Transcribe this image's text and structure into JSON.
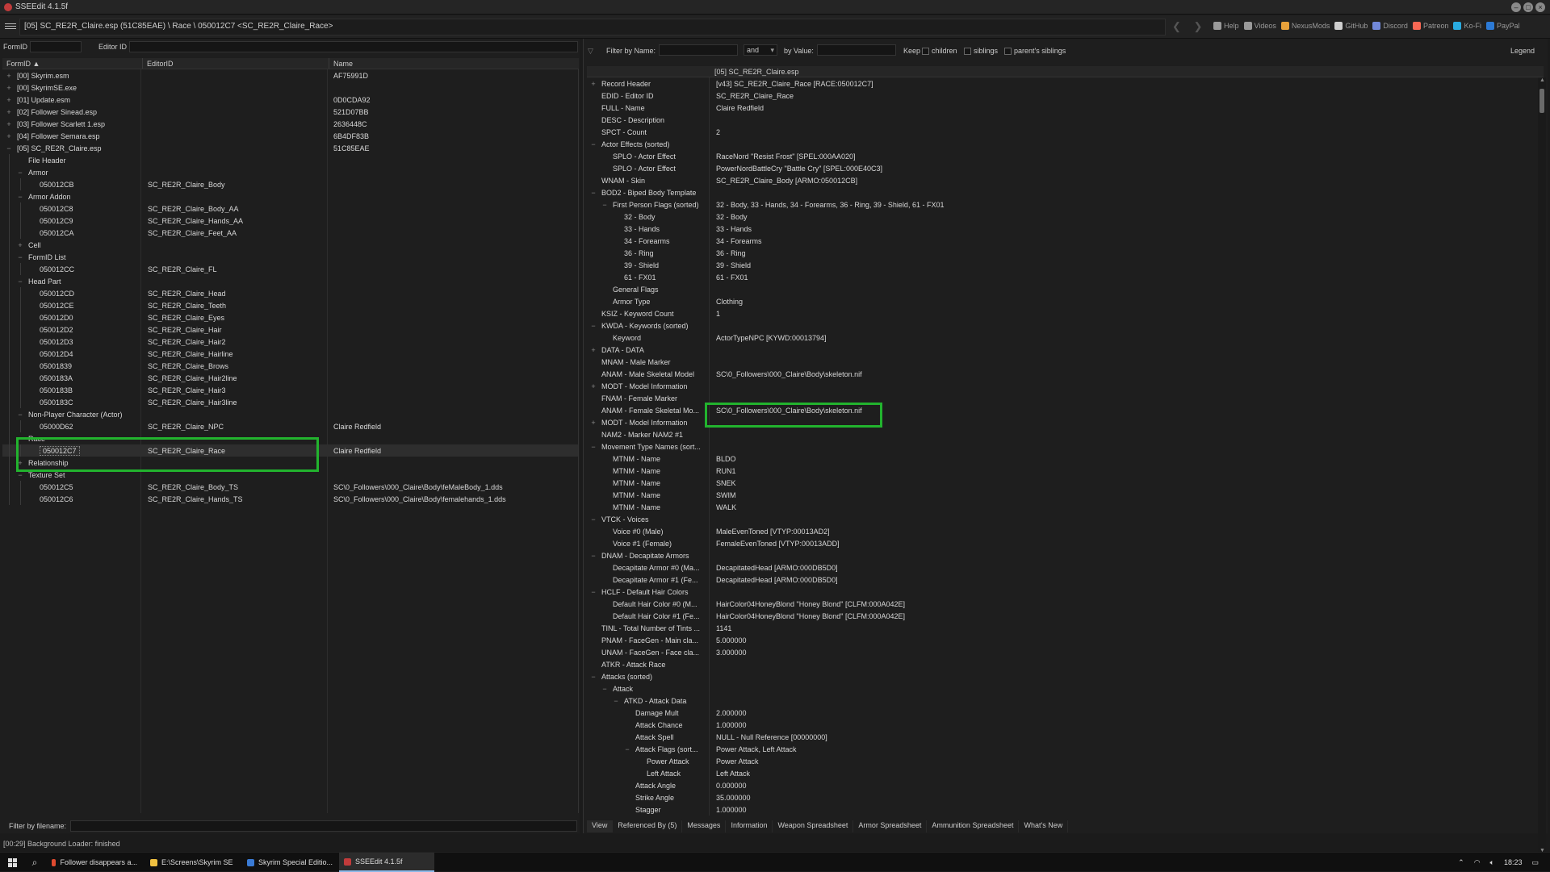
{
  "window": {
    "title": "SSEEdit 4.1.5f"
  },
  "toolbar": {
    "path": "[05] SC_RE2R_Claire.esp (51C85EAE) \\ Race \\ 050012C7 <SC_RE2R_Claire_Race>",
    "nav_back": "❮",
    "nav_fwd": "❯",
    "links": [
      {
        "label": "Help",
        "icon": "help-icon",
        "color": "#9a9a9a"
      },
      {
        "label": "Videos",
        "icon": "videos-icon",
        "color": "#9a9a9a"
      },
      {
        "label": "NexusMods",
        "icon": "nexusmods-icon",
        "color": "#e8a13a"
      },
      {
        "label": "GitHub",
        "icon": "github-icon",
        "color": "#cfcfcf"
      },
      {
        "label": "Discord",
        "icon": "discord-icon",
        "color": "#7289da"
      },
      {
        "label": "Patreon",
        "icon": "patreon-icon",
        "color": "#f96854"
      },
      {
        "label": "Ko-Fi",
        "icon": "kofi-icon",
        "color": "#29abe0"
      },
      {
        "label": "PayPal",
        "icon": "paypal-icon",
        "color": "#2c7ad6"
      }
    ]
  },
  "left": {
    "formid_label": "FormID",
    "editorid_label": "Editor ID",
    "columns": [
      "FormID ▲",
      "EditorID",
      "Name"
    ],
    "filter_filename_label": "Filter by filename:",
    "rows": [
      {
        "indent": 0,
        "exp": "+",
        "c0": "[00] Skyrim.esm",
        "c1": "",
        "c2": "AF75991D"
      },
      {
        "indent": 0,
        "exp": "+",
        "c0": "[00] SkyrimSE.exe",
        "c1": "",
        "c2": ""
      },
      {
        "indent": 0,
        "exp": "+",
        "c0": "[01] Update.esm",
        "c1": "",
        "c2": "0D0CDA92"
      },
      {
        "indent": 0,
        "exp": "+",
        "c0": "[02] Follower Sinead.esp",
        "c1": "",
        "c2": "521D07BB"
      },
      {
        "indent": 0,
        "exp": "+",
        "c0": "[03] Follower Scarlett 1.esp",
        "c1": "",
        "c2": "2636448C"
      },
      {
        "indent": 0,
        "exp": "+",
        "c0": "[04] Follower Semara.esp",
        "c1": "",
        "c2": "6B4DF83B"
      },
      {
        "indent": 0,
        "exp": "−",
        "c0": "[05] SC_RE2R_Claire.esp",
        "c1": "",
        "c2": "51C85EAE"
      },
      {
        "indent": 1,
        "exp": "",
        "c0": "File Header",
        "c1": "",
        "c2": ""
      },
      {
        "indent": 1,
        "exp": "−",
        "c0": "Armor",
        "c1": "",
        "c2": ""
      },
      {
        "indent": 2,
        "exp": "",
        "c0": "050012CB",
        "c1": "SC_RE2R_Claire_Body",
        "c2": ""
      },
      {
        "indent": 1,
        "exp": "−",
        "c0": "Armor Addon",
        "c1": "",
        "c2": ""
      },
      {
        "indent": 2,
        "exp": "",
        "c0": "050012C8",
        "c1": "SC_RE2R_Claire_Body_AA",
        "c2": ""
      },
      {
        "indent": 2,
        "exp": "",
        "c0": "050012C9",
        "c1": "SC_RE2R_Claire_Hands_AA",
        "c2": ""
      },
      {
        "indent": 2,
        "exp": "",
        "c0": "050012CA",
        "c1": "SC_RE2R_Claire_Feet_AA",
        "c2": ""
      },
      {
        "indent": 1,
        "exp": "+",
        "c0": "Cell",
        "c1": "",
        "c2": ""
      },
      {
        "indent": 1,
        "exp": "−",
        "c0": "FormID List",
        "c1": "",
        "c2": ""
      },
      {
        "indent": 2,
        "exp": "",
        "c0": "050012CC",
        "c1": "SC_RE2R_Claire_FL",
        "c2": ""
      },
      {
        "indent": 1,
        "exp": "−",
        "c0": "Head Part",
        "c1": "",
        "c2": ""
      },
      {
        "indent": 2,
        "exp": "",
        "c0": "050012CD",
        "c1": "SC_RE2R_Claire_Head",
        "c2": ""
      },
      {
        "indent": 2,
        "exp": "",
        "c0": "050012CE",
        "c1": "SC_RE2R_Claire_Teeth",
        "c2": ""
      },
      {
        "indent": 2,
        "exp": "",
        "c0": "050012D0",
        "c1": "SC_RE2R_Claire_Eyes",
        "c2": ""
      },
      {
        "indent": 2,
        "exp": "",
        "c0": "050012D2",
        "c1": "SC_RE2R_Claire_Hair",
        "c2": ""
      },
      {
        "indent": 2,
        "exp": "",
        "c0": "050012D3",
        "c1": "SC_RE2R_Claire_Hair2",
        "c2": ""
      },
      {
        "indent": 2,
        "exp": "",
        "c0": "050012D4",
        "c1": "SC_RE2R_Claire_Hairline",
        "c2": ""
      },
      {
        "indent": 2,
        "exp": "",
        "c0": "05001839",
        "c1": "SC_RE2R_Claire_Brows",
        "c2": ""
      },
      {
        "indent": 2,
        "exp": "",
        "c0": "0500183A",
        "c1": "SC_RE2R_Claire_Hair2line",
        "c2": ""
      },
      {
        "indent": 2,
        "exp": "",
        "c0": "0500183B",
        "c1": "SC_RE2R_Claire_Hair3",
        "c2": ""
      },
      {
        "indent": 2,
        "exp": "",
        "c0": "0500183C",
        "c1": "SC_RE2R_Claire_Hair3line",
        "c2": ""
      },
      {
        "indent": 1,
        "exp": "−",
        "c0": "Non-Player Character (Actor)",
        "c1": "",
        "c2": ""
      },
      {
        "indent": 2,
        "exp": "",
        "c0": "05000D62",
        "c1": "SC_RE2R_Claire_NPC",
        "c2": "Claire Redfield"
      },
      {
        "indent": 1,
        "exp": "−",
        "c0": "Race",
        "c1": "",
        "c2": ""
      },
      {
        "indent": 2,
        "exp": "",
        "c0": "050012C7",
        "c1": "SC_RE2R_Claire_Race",
        "c2": "Claire Redfield",
        "selected": true
      },
      {
        "indent": 1,
        "exp": "+",
        "c0": "Relationship",
        "c1": "",
        "c2": ""
      },
      {
        "indent": 1,
        "exp": "−",
        "c0": "Texture Set",
        "c1": "",
        "c2": ""
      },
      {
        "indent": 2,
        "exp": "",
        "c0": "050012C5",
        "c1": "SC_RE2R_Claire_Body_TS",
        "c2": "SC\\0_Followers\\000_Claire\\Body\\feMaleBody_1.dds"
      },
      {
        "indent": 2,
        "exp": "",
        "c0": "050012C6",
        "c1": "SC_RE2R_Claire_Hands_TS",
        "c2": "SC\\0_Followers\\000_Claire\\Body\\femalehands_1.dds"
      }
    ]
  },
  "status": "[00:29] Background Loader: finished",
  "right": {
    "filter_name_label": "Filter by Name:",
    "and_label": "and",
    "by_value_label": "by Value:",
    "keep_label": "Keep",
    "children_label": "children",
    "siblings_label": "siblings",
    "parents_label": "parent's siblings",
    "legend_label": "Legend",
    "file_header": "[05] SC_RE2R_Claire.esp",
    "rows": [
      {
        "i": 0,
        "e": "+",
        "k": "Record Header",
        "v": "[v43] SC_RE2R_Claire_Race [RACE:050012C7]"
      },
      {
        "i": 0,
        "e": "",
        "k": "EDID - Editor ID",
        "v": "SC_RE2R_Claire_Race"
      },
      {
        "i": 0,
        "e": "",
        "k": "FULL - Name",
        "v": "Claire Redfield"
      },
      {
        "i": 0,
        "e": "",
        "k": "DESC - Description",
        "v": ""
      },
      {
        "i": 0,
        "e": "",
        "k": "SPCT - Count",
        "v": "2"
      },
      {
        "i": 0,
        "e": "−",
        "k": "Actor Effects (sorted)",
        "v": ""
      },
      {
        "i": 1,
        "e": "",
        "k": "SPLO - Actor Effect",
        "v": "RaceNord \"Resist Frost\" [SPEL:000AA020]"
      },
      {
        "i": 1,
        "e": "",
        "k": "SPLO - Actor Effect",
        "v": "PowerNordBattleCry \"Battle Cry\" [SPEL:000E40C3]"
      },
      {
        "i": 0,
        "e": "",
        "k": "WNAM - Skin",
        "v": "SC_RE2R_Claire_Body [ARMO:050012CB]"
      },
      {
        "i": 0,
        "e": "−",
        "k": "BOD2 - Biped Body Template",
        "v": ""
      },
      {
        "i": 1,
        "e": "−",
        "k": "First Person Flags (sorted)",
        "v": "32 - Body, 33 - Hands, 34 - Forearms, 36 - Ring, 39 - Shield, 61 - FX01"
      },
      {
        "i": 2,
        "e": "",
        "k": "32 - Body",
        "v": "32 - Body"
      },
      {
        "i": 2,
        "e": "",
        "k": "33 - Hands",
        "v": "33 - Hands"
      },
      {
        "i": 2,
        "e": "",
        "k": "34 - Forearms",
        "v": "34 - Forearms"
      },
      {
        "i": 2,
        "e": "",
        "k": "36 - Ring",
        "v": "36 - Ring"
      },
      {
        "i": 2,
        "e": "",
        "k": "39 - Shield",
        "v": "39 - Shield"
      },
      {
        "i": 2,
        "e": "",
        "k": "61 - FX01",
        "v": "61 - FX01"
      },
      {
        "i": 1,
        "e": "",
        "k": "General Flags",
        "v": ""
      },
      {
        "i": 1,
        "e": "",
        "k": "Armor Type",
        "v": "Clothing"
      },
      {
        "i": 0,
        "e": "",
        "k": "KSIZ - Keyword Count",
        "v": "1"
      },
      {
        "i": 0,
        "e": "−",
        "k": "KWDA - Keywords (sorted)",
        "v": ""
      },
      {
        "i": 1,
        "e": "",
        "k": "Keyword",
        "v": "ActorTypeNPC [KYWD:00013794]"
      },
      {
        "i": 0,
        "e": "+",
        "k": "DATA - DATA",
        "v": ""
      },
      {
        "i": 0,
        "e": "",
        "k": "MNAM - Male Marker",
        "v": ""
      },
      {
        "i": 0,
        "e": "",
        "k": "ANAM - Male Skeletal Model",
        "v": "SC\\0_Followers\\000_Claire\\Body\\skeleton.nif"
      },
      {
        "i": 0,
        "e": "+",
        "k": "MODT - Model Information",
        "v": ""
      },
      {
        "i": 0,
        "e": "",
        "k": "FNAM - Female Marker",
        "v": ""
      },
      {
        "i": 0,
        "e": "",
        "k": "ANAM - Female Skeletal Mo...",
        "v": "SC\\0_Followers\\000_Claire\\Body\\skeleton.nif"
      },
      {
        "i": 0,
        "e": "+",
        "k": "MODT - Model Information",
        "v": ""
      },
      {
        "i": 0,
        "e": "",
        "k": "NAM2 - Marker NAM2 #1",
        "v": ""
      },
      {
        "i": 0,
        "e": "−",
        "k": "Movement Type Names (sort...",
        "v": ""
      },
      {
        "i": 1,
        "e": "",
        "k": "MTNM - Name",
        "v": "BLDO"
      },
      {
        "i": 1,
        "e": "",
        "k": "MTNM - Name",
        "v": "RUN1"
      },
      {
        "i": 1,
        "e": "",
        "k": "MTNM - Name",
        "v": "SNEK"
      },
      {
        "i": 1,
        "e": "",
        "k": "MTNM - Name",
        "v": "SWIM"
      },
      {
        "i": 1,
        "e": "",
        "k": "MTNM - Name",
        "v": "WALK"
      },
      {
        "i": 0,
        "e": "−",
        "k": "VTCK - Voices",
        "v": ""
      },
      {
        "i": 1,
        "e": "",
        "k": "Voice #0 (Male)",
        "v": "MaleEvenToned [VTYP:00013AD2]"
      },
      {
        "i": 1,
        "e": "",
        "k": "Voice #1 (Female)",
        "v": "FemaleEvenToned [VTYP:00013ADD]"
      },
      {
        "i": 0,
        "e": "−",
        "k": "DNAM - Decapitate Armors",
        "v": ""
      },
      {
        "i": 1,
        "e": "",
        "k": "Decapitate Armor #0 (Ma...",
        "v": "DecapitatedHead [ARMO:000DB5D0]"
      },
      {
        "i": 1,
        "e": "",
        "k": "Decapitate Armor #1 (Fe...",
        "v": "DecapitatedHead [ARMO:000DB5D0]"
      },
      {
        "i": 0,
        "e": "−",
        "k": "HCLF - Default Hair Colors",
        "v": ""
      },
      {
        "i": 1,
        "e": "",
        "k": "Default Hair Color #0 (M...",
        "v": "HairColor04HoneyBlond \"Honey Blond\" [CLFM:000A042E]"
      },
      {
        "i": 1,
        "e": "",
        "k": "Default Hair Color #1 (Fe...",
        "v": "HairColor04HoneyBlond \"Honey Blond\" [CLFM:000A042E]"
      },
      {
        "i": 0,
        "e": "",
        "k": "TINL - Total Number of Tints ...",
        "v": "1141"
      },
      {
        "i": 0,
        "e": "",
        "k": "PNAM - FaceGen - Main cla...",
        "v": "5.000000"
      },
      {
        "i": 0,
        "e": "",
        "k": "UNAM - FaceGen - Face cla...",
        "v": "3.000000"
      },
      {
        "i": 0,
        "e": "",
        "k": "ATKR - Attack Race",
        "v": ""
      },
      {
        "i": 0,
        "e": "−",
        "k": "Attacks (sorted)",
        "v": ""
      },
      {
        "i": 1,
        "e": "−",
        "k": "Attack",
        "v": ""
      },
      {
        "i": 2,
        "e": "−",
        "k": "ATKD - Attack Data",
        "v": ""
      },
      {
        "i": 3,
        "e": "",
        "k": "Damage Mult",
        "v": "2.000000"
      },
      {
        "i": 3,
        "e": "",
        "k": "Attack Chance",
        "v": "1.000000"
      },
      {
        "i": 3,
        "e": "",
        "k": "Attack Spell",
        "v": "NULL - Null Reference [00000000]"
      },
      {
        "i": 3,
        "e": "−",
        "k": "Attack Flags (sort...",
        "v": "Power Attack, Left Attack"
      },
      {
        "i": 4,
        "e": "",
        "k": "Power Attack",
        "v": "Power Attack"
      },
      {
        "i": 4,
        "e": "",
        "k": "Left Attack",
        "v": "Left Attack"
      },
      {
        "i": 3,
        "e": "",
        "k": "Attack Angle",
        "v": "0.000000"
      },
      {
        "i": 3,
        "e": "",
        "k": "Strike Angle",
        "v": "35.000000"
      },
      {
        "i": 3,
        "e": "",
        "k": "Stagger",
        "v": "1.000000"
      }
    ],
    "tabs": [
      "View",
      "Referenced By (5)",
      "Messages",
      "Information",
      "Weapon Spreadsheet",
      "Armor Spreadsheet",
      "Ammunition Spreadsheet",
      "What's New"
    ]
  },
  "taskbar": {
    "items": [
      {
        "label": "Follower disappears a...",
        "color": "#e04a2f"
      },
      {
        "label": "E:\\Screens\\Skyrim SE",
        "color": "#f0c040"
      },
      {
        "label": "Skyrim Special Editio...",
        "color": "#3a7bd5"
      },
      {
        "label": "SSEEdit 4.1.5f",
        "color": "#c23b3b"
      }
    ],
    "clock": "18:23"
  }
}
